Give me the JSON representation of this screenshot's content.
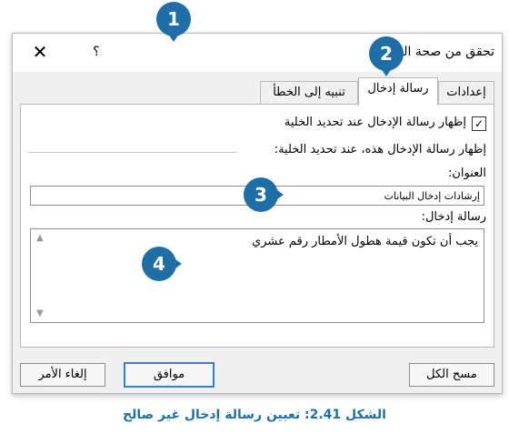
{
  "dialog": {
    "title": "تحقق من صحة البيانات",
    "close_glyph": "✕",
    "help_glyph": "؟",
    "tabs": [
      {
        "label": "إعدادات"
      },
      {
        "label": "رسالة إدخال"
      },
      {
        "label": "تنبيه إلى الخطأ"
      }
    ],
    "checkbox": {
      "label": "إظهار رسالة الإدخال عند تحديد الخلية",
      "checked_glyph": "✓"
    },
    "section_label": "إظهار رسالة الإدخال هذه، عند تحديد الخلية:",
    "title_field": {
      "label": "العنوان:",
      "value": "إرشادات إدخال البيانات"
    },
    "message_field": {
      "label": "رسالة إدخال:",
      "value": "يجب أن تكون قيمة هطول الأمطار رقم عشري"
    },
    "buttons": {
      "clear": "مسح الكل",
      "ok": "موافق",
      "cancel": "إلغاء الأمر"
    }
  },
  "callouts": [
    "1",
    "2",
    "3",
    "4"
  ],
  "caption": "الشكل 2.41: تعيين رسالة إدخال غير صالح"
}
